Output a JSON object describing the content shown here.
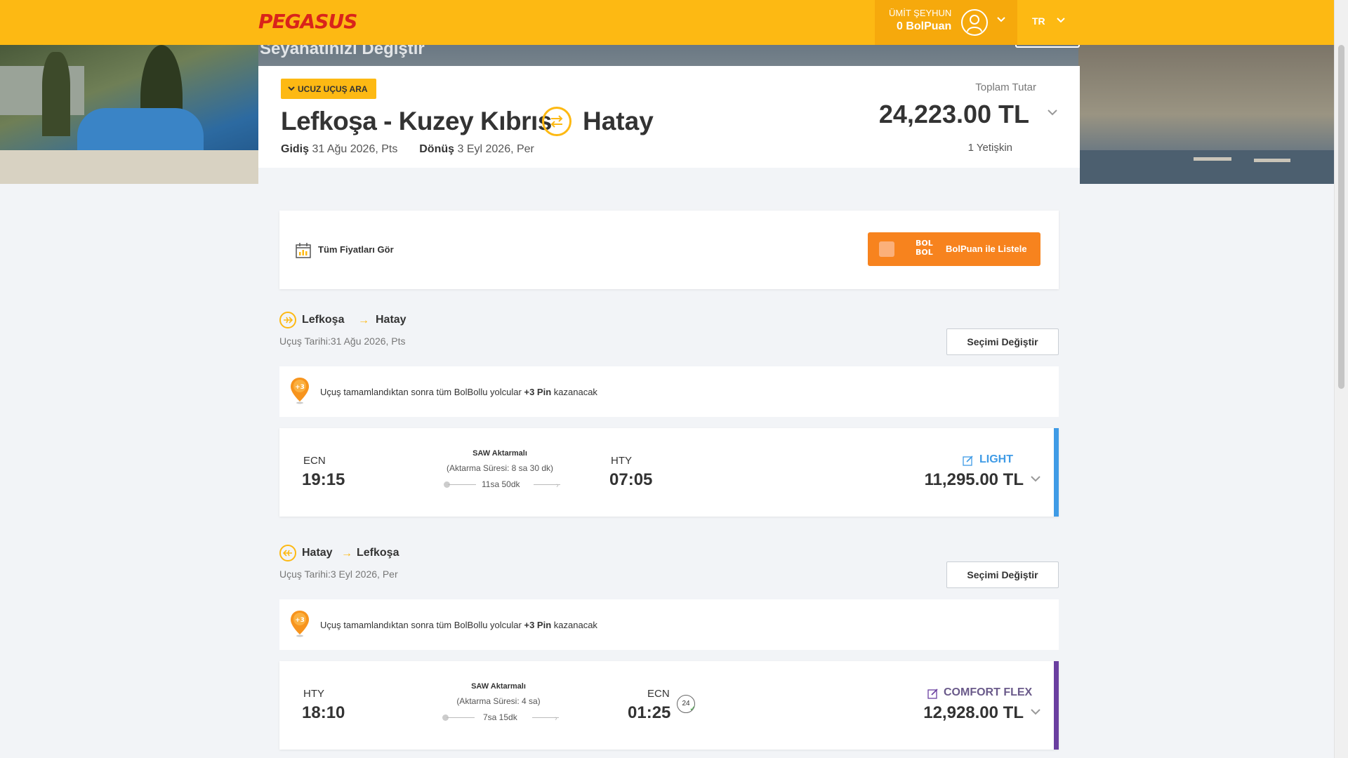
{
  "header": {
    "logo": "PEGASUS",
    "user_name": "ÜMİT ŞEYHUN",
    "user_points": "0 BolPuan",
    "language": "TR"
  },
  "hero": {
    "ghost_title": "Seyahatinizi Değiştir"
  },
  "summary": {
    "tag": "UCUZ UÇUŞ ARA",
    "origin": "Lefkoşa - Kuzey Kıbrıs",
    "destination": "Hatay",
    "departure_label": "Gidiş",
    "departure_date": "31 Ağu 2026, Pts",
    "return_label": "Dönüş",
    "return_date": "3 Eyl 2026, Per",
    "total_label": "Toplam Tutar",
    "total_value": "24,223.00 TL",
    "passengers": "1 Yetişkin"
  },
  "filters": {
    "all_prices": "Tüm Fiyatları Gör",
    "bolbol_logo": "BOL BOL",
    "bolpuan_list": "BolPuan ile Listele"
  },
  "legs": [
    {
      "from": "Lefkoşa",
      "to": "Hatay",
      "date": "Uçuş Tarihi:31 Ağu 2026, Pts",
      "change_button": "Seçimi Değiştir",
      "pin_prefix": "Uçuş tamamlandıktan sonra tüm BolBollu yolcular",
      "pin_bold": "+3 Pin",
      "pin_suffix": "kazanacak",
      "dep_code": "ECN",
      "dep_time": "19:15",
      "transfer": "SAW Aktarmalı",
      "transfer_duration": "(Aktarma Süresi: 8 sa 30 dk)",
      "flight_duration": "11sa 50dk",
      "arr_code": "HTY",
      "arr_time": "07:05",
      "fare_name": "LIGHT",
      "fare_price": "11,295.00 TL",
      "fare_color": "#3f9be6"
    },
    {
      "from": "Hatay",
      "to": "Lefkoşa",
      "date": "Uçuş Tarihi:3 Eyl 2026, Per",
      "change_button": "Seçimi Değiştir",
      "pin_prefix": "Uçuş tamamlandıktan sonra tüm BolBollu yolcular",
      "pin_bold": "+3 Pin",
      "pin_suffix": "kazanacak",
      "dep_code": "HTY",
      "dep_time": "18:10",
      "transfer": "SAW Aktarmalı",
      "transfer_duration": "(Aktarma Süresi: 4 sa)",
      "flight_duration": "7sa 15dk",
      "arr_code": "ECN",
      "arr_time": "01:25",
      "badge": "24",
      "fare_name": "COMFORT FLEX",
      "fare_price": "12,928.00 TL",
      "fare_color": "#6a3fa0"
    }
  ],
  "colors": {
    "brand_yellow": "#fdb913",
    "brand_red": "#d9241b",
    "bolpuan_orange": "#f7831e"
  },
  "icons": [
    "user-icon",
    "chevron-down-icon",
    "swap-icon",
    "calendar-icon",
    "plane-icon",
    "pin-icon",
    "edit-icon",
    "check-24-icon"
  ]
}
